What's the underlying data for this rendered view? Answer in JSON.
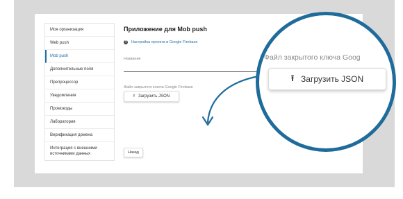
{
  "sidebar": {
    "items": [
      {
        "label": "Моя организация",
        "active": false
      },
      {
        "label": "Web push",
        "active": false
      },
      {
        "label": "Mob push",
        "active": true
      },
      {
        "label": "Дополнительные поля",
        "active": false
      },
      {
        "label": "Препроцессор",
        "active": false
      },
      {
        "label": "Уведомления",
        "active": false
      },
      {
        "label": "Промокоды",
        "active": false
      },
      {
        "label": "Лаборатория",
        "active": false
      },
      {
        "label": "Верификация домена",
        "active": false
      },
      {
        "label": "Интеграция с внешними источниками данных",
        "active": false
      }
    ]
  },
  "main": {
    "title": "Приложение для Mob push",
    "help_link": "Настройка проекта в Google Firebase",
    "name_label": "Название",
    "key_label": "Файл закрытого ключа Google Firebase",
    "upload_button": "Загрузить JSON",
    "back_button": "Назад"
  },
  "magnifier": {
    "label": "Файл закрытого ключа Goog",
    "button": "Загрузить JSON"
  },
  "icons": {
    "help": "info-circle-icon",
    "upload": "upload-arrow-icon",
    "pointer": "curved-arrow-icon"
  },
  "colors": {
    "accent": "#1e6fa8",
    "magnifier_border": "#1f6c9c",
    "backdrop": "#d9d9d9"
  }
}
